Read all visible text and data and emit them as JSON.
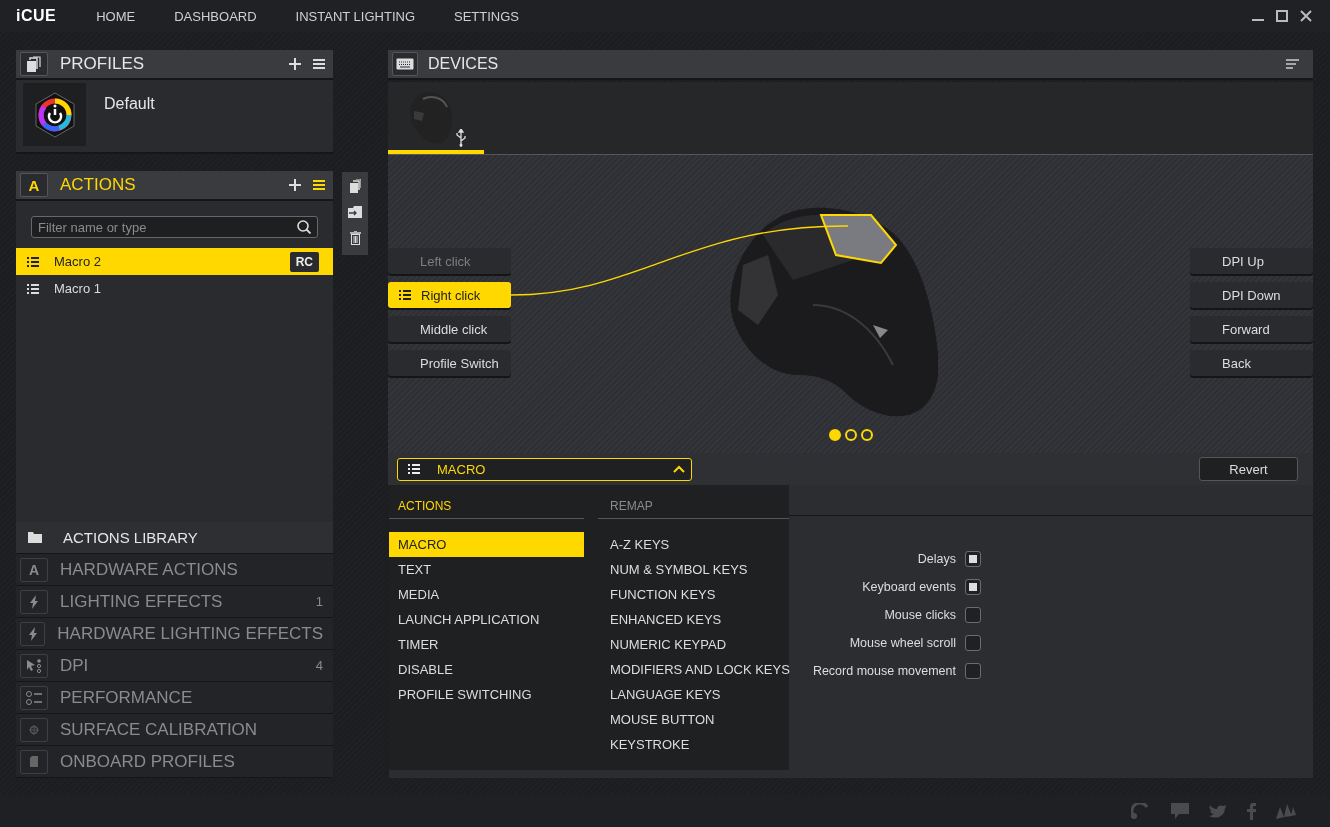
{
  "topbar": {
    "logo": "iCUE",
    "nav": [
      {
        "label": "HOME"
      },
      {
        "label": "DASHBOARD"
      },
      {
        "label": "INSTANT LIGHTING"
      },
      {
        "label": "SETTINGS"
      }
    ]
  },
  "profiles": {
    "title": "PROFILES",
    "items": [
      {
        "name": "Default"
      }
    ]
  },
  "actions": {
    "title": "ACTIONS",
    "icon_letter": "A",
    "filter_placeholder": "Filter name or type",
    "items": [
      {
        "name": "Macro 2",
        "badge": "RC",
        "selected": true
      },
      {
        "name": "Macro 1",
        "selected": false
      }
    ]
  },
  "library": {
    "title": "ACTIONS LIBRARY",
    "items": [
      {
        "label": "HARDWARE ACTIONS",
        "kind": "letter",
        "icon_letter": "A"
      },
      {
        "label": "LIGHTING EFFECTS",
        "kind": "bolt",
        "count": "1"
      },
      {
        "label": "HARDWARE LIGHTING EFFECTS",
        "kind": "bolt"
      },
      {
        "label": "DPI",
        "kind": "cursor",
        "count": "4"
      },
      {
        "label": "PERFORMANCE",
        "kind": "toggles"
      },
      {
        "label": "SURFACE CALIBRATION",
        "kind": "target"
      },
      {
        "label": "ONBOARD PROFILES",
        "kind": "chip"
      }
    ]
  },
  "devices": {
    "title": "DEVICES",
    "tabs": [
      {
        "selected": true
      }
    ],
    "left_buttons": [
      {
        "label": "Left click",
        "disabled": true,
        "selected": false
      },
      {
        "label": "Right click",
        "disabled": false,
        "selected": true
      },
      {
        "label": "Middle click",
        "disabled": false,
        "selected": false
      },
      {
        "label": "Profile Switch",
        "disabled": false,
        "selected": false
      }
    ],
    "right_buttons": [
      {
        "label": "DPI Up",
        "disabled": false,
        "selected": false
      },
      {
        "label": "DPI Down",
        "disabled": false,
        "selected": false
      },
      {
        "label": "Forward",
        "disabled": false,
        "selected": false
      },
      {
        "label": "Back",
        "disabled": false,
        "selected": false
      }
    ],
    "pages": [
      {
        "selected": true
      },
      {
        "selected": false
      },
      {
        "selected": false
      }
    ]
  },
  "assignment": {
    "value": "MACRO",
    "expanded": true,
    "revert": "Revert",
    "menu": [
      {
        "title": "ACTIONS",
        "active": true,
        "items": [
          {
            "label": "MACRO",
            "selected": true
          },
          {
            "label": "TEXT",
            "selected": false
          },
          {
            "label": "MEDIA",
            "selected": false
          },
          {
            "label": "LAUNCH APPLICATION",
            "selected": false
          },
          {
            "label": "TIMER",
            "selected": false
          },
          {
            "label": "DISABLE",
            "selected": false
          },
          {
            "label": "PROFILE SWITCHING",
            "selected": false
          }
        ]
      },
      {
        "title": "REMAP",
        "active": false,
        "items": [
          {
            "label": "A-Z KEYS",
            "selected": false
          },
          {
            "label": "NUM & SYMBOL KEYS",
            "selected": false
          },
          {
            "label": "FUNCTION KEYS",
            "selected": false
          },
          {
            "label": "ENHANCED KEYS",
            "selected": false
          },
          {
            "label": "NUMERIC KEYPAD",
            "selected": false
          },
          {
            "label": "MODIFIERS AND LOCK KEYS",
            "selected": false
          },
          {
            "label": "LANGUAGE KEYS",
            "selected": false
          },
          {
            "label": "MOUSE BUTTON",
            "selected": false
          },
          {
            "label": "KEYSTROKE",
            "selected": false
          }
        ]
      }
    ],
    "options": [
      {
        "label": "Delays",
        "checked": true
      },
      {
        "label": "Keyboard events",
        "checked": true
      },
      {
        "label": "Mouse clicks",
        "checked": false
      },
      {
        "label": "Mouse wheel scroll",
        "checked": false
      },
      {
        "label": "Record mouse movement",
        "checked": false
      }
    ]
  }
}
